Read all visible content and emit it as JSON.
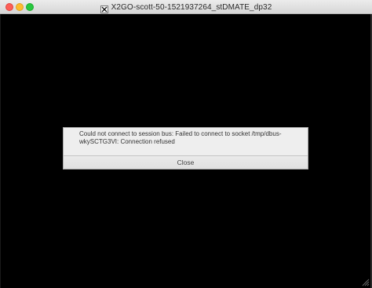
{
  "window": {
    "title": "X2GO-scott-50-1521937264_stDMATE_dp32",
    "icon": "x11-icon",
    "controls": {
      "close": "close-window-button",
      "minimize": "minimize-window-button",
      "zoom": "zoom-window-button"
    }
  },
  "dialog": {
    "message": "Could not connect to session bus: Failed to connect to socket /tmp/dbus-wkySCTG3VI: Connection refused",
    "button_label": "Close"
  },
  "colors": {
    "background": "#000000",
    "titlebar": "#e0e0e0",
    "dialog_bg": "#eeeeee",
    "close_red": "#fd5f57",
    "minimize_yellow": "#fdbc2e",
    "zoom_green": "#28c840"
  }
}
